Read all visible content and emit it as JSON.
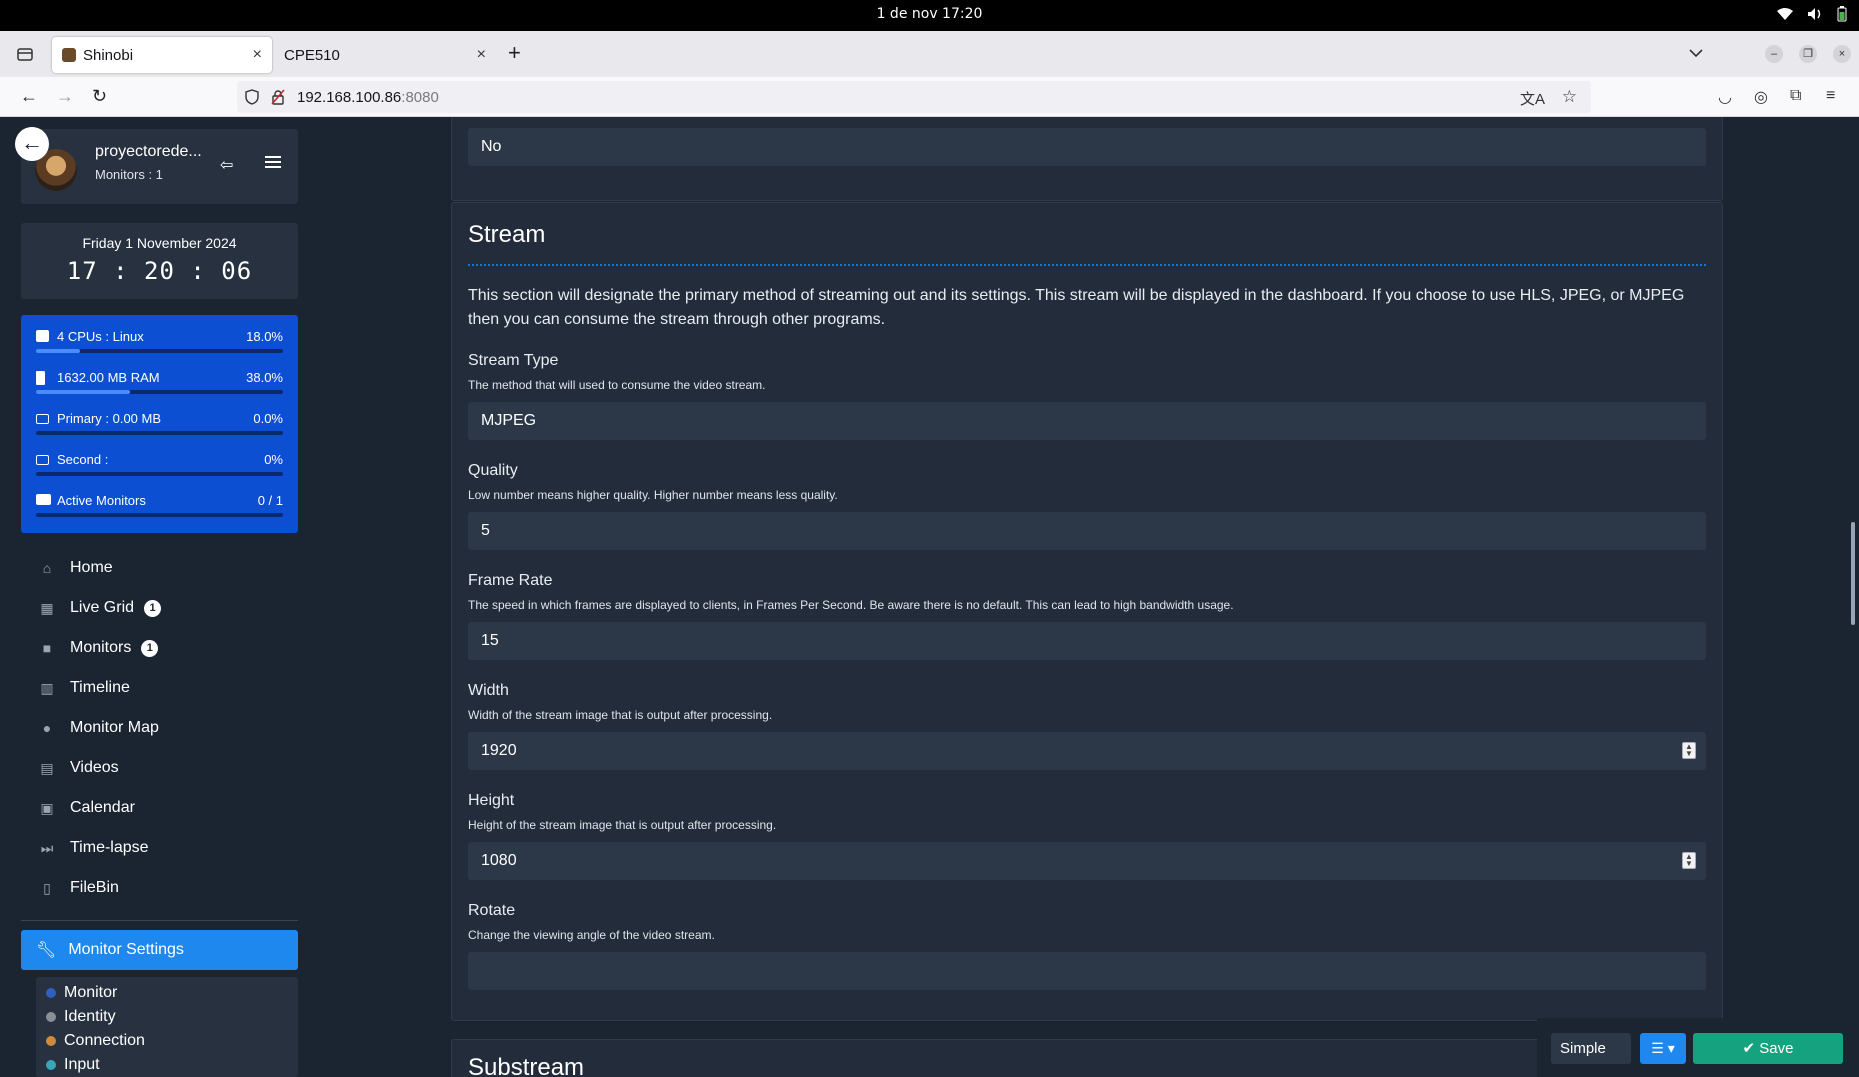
{
  "os": {
    "clock": "1 de nov  17:20"
  },
  "browser": {
    "tabs": [
      {
        "label": "Shinobi"
      },
      {
        "label": "CPE510"
      }
    ],
    "url_host": "192.168.100.86",
    "url_port": ":8080"
  },
  "sidebar": {
    "user": {
      "name": "proyectorede...",
      "monitors": "Monitors : 1"
    },
    "clock": {
      "date": "Friday 1 November 2024",
      "time": "17 : 20 : 06"
    },
    "stats": [
      {
        "label": "4 CPUs : Linux",
        "value": "18.0%",
        "fill": 0.18
      },
      {
        "label": "1632.00 MB RAM",
        "value": "38.0%",
        "fill": 0.38
      },
      {
        "label": "Primary : 0.00 MB",
        "value": "0.0%",
        "fill": 0
      },
      {
        "label": "Second :",
        "value": "0%",
        "fill": 0
      },
      {
        "label": "Active Monitors",
        "value": "0 / 1",
        "fill": 0
      }
    ],
    "nav": [
      {
        "label": "Home",
        "icon": "home-icon"
      },
      {
        "label": "Live Grid",
        "icon": "grid-icon",
        "badge": "1"
      },
      {
        "label": "Monitors",
        "icon": "video-camera-icon",
        "badge": "1"
      },
      {
        "label": "Timeline",
        "icon": "barcode-icon"
      },
      {
        "label": "Monitor Map",
        "icon": "map-marker-icon"
      },
      {
        "label": "Videos",
        "icon": "film-icon"
      },
      {
        "label": "Calendar",
        "icon": "calendar-icon"
      },
      {
        "label": "Time-lapse",
        "icon": "fast-forward-icon"
      },
      {
        "label": "FileBin",
        "icon": "file-icon"
      }
    ],
    "settings_label": "Monitor Settings",
    "sub_sections": [
      {
        "label": "Monitor",
        "color": "#2f5fbf"
      },
      {
        "label": "Identity",
        "color": "#8a8f98"
      },
      {
        "label": "Connection",
        "color": "#d08a3a"
      },
      {
        "label": "Input",
        "color": "#3aa6b9"
      }
    ]
  },
  "main": {
    "top_field_value": "No",
    "stream": {
      "title": "Stream",
      "description": "This section will designate the primary method of streaming out and its settings. This stream will be displayed in the dashboard. If you choose to use HLS, JPEG, or MJPEG then you can consume the stream through other programs.",
      "fields": {
        "type": {
          "label": "Stream Type",
          "help": "The method that will used to consume the video stream.",
          "value": "MJPEG"
        },
        "quality": {
          "label": "Quality",
          "help": "Low number means higher quality. Higher number means less quality.",
          "value": "5"
        },
        "fps": {
          "label": "Frame Rate",
          "help": "The speed in which frames are displayed to clients, in Frames Per Second. Be aware there is no default. This can lead to high bandwidth usage.",
          "value": "15"
        },
        "width": {
          "label": "Width",
          "help": "Width of the stream image that is output after processing.",
          "value": "1920"
        },
        "height": {
          "label": "Height",
          "help": "Height of the stream image that is output after processing.",
          "value": "1080"
        },
        "rotate": {
          "label": "Rotate",
          "help": "Change the viewing angle of the video stream.",
          "value": ""
        }
      }
    },
    "substream_title": "Substream"
  },
  "toolbar": {
    "simple_label": "Simple",
    "save_label": "Save"
  },
  "colors": {
    "accent": "#1e88ef",
    "stats_bg": "#0d4fd3",
    "save": "#15a37f",
    "bg": "#1b2431"
  }
}
